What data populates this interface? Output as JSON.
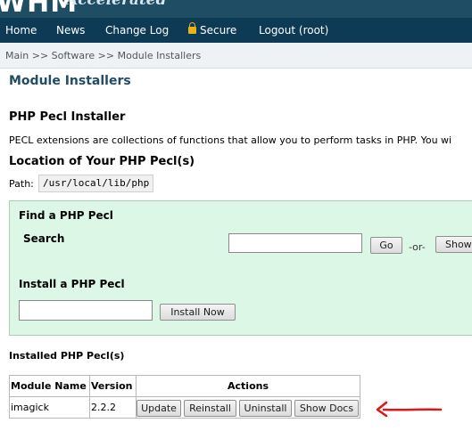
{
  "header": {
    "logo_text": "WHM",
    "logo_subtitle": "Accelerated"
  },
  "nav": {
    "items": [
      {
        "label": "Home"
      },
      {
        "label": "News"
      },
      {
        "label": "Change Log"
      },
      {
        "label": "Secure",
        "icon": "lock-icon"
      },
      {
        "label": "Logout (root)"
      }
    ]
  },
  "breadcrumb": "Main >> Software >> Module Installers",
  "page": {
    "title": "Module Installers",
    "section_title": "PHP Pecl Installer",
    "description": "PECL extensions are collections of functions that allow you to perform tasks in PHP. You wi",
    "location_title": "Location of Your PHP Pecl(s)",
    "path_label": "Path:",
    "path_value": "/usr/local/lib/php"
  },
  "find": {
    "title": "Find a PHP Pecl",
    "search_label": "Search",
    "search_value": "",
    "go_label": "Go",
    "or_text": "-or-",
    "show_label": "Show"
  },
  "install": {
    "title": "Install a PHP Pecl",
    "input_value": "",
    "button_label": "Install Now"
  },
  "installed": {
    "title": "Installed PHP Pecl(s)",
    "columns": [
      "Module Name",
      "Version",
      "Actions"
    ],
    "rows": [
      {
        "name": "imagick",
        "version": "2.2.2",
        "actions": [
          "Update",
          "Reinstall",
          "Uninstall",
          "Show Docs"
        ]
      }
    ]
  },
  "colors": {
    "banner": "#1f4d63",
    "navbar": "#0d3a55",
    "panel_bg": "#ddf7e6",
    "annotation_arrow": "#e01515"
  }
}
